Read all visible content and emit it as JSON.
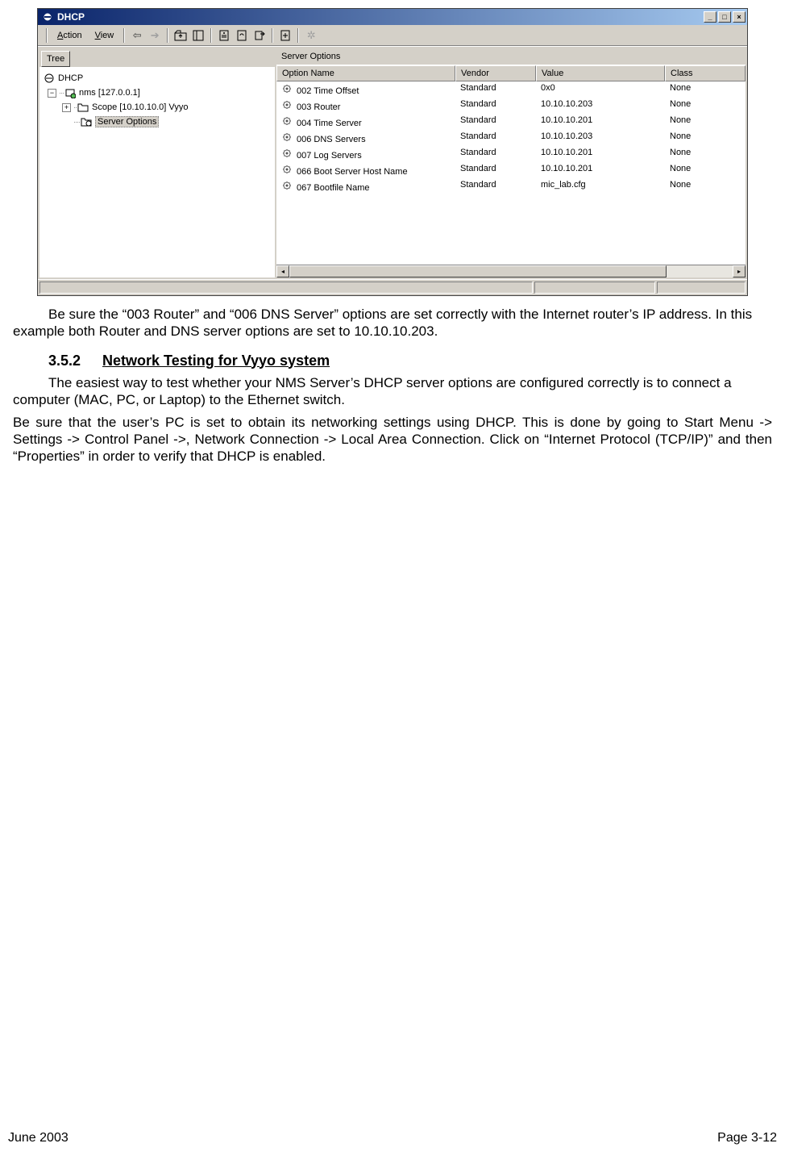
{
  "window": {
    "title": "DHCP",
    "menu": {
      "action": "Action",
      "view": "View"
    },
    "left_tab": "Tree",
    "right_title": "Server Options",
    "tree": {
      "root": "DHCP",
      "node1": "nms [127.0.0.1]",
      "node2": "Scope [10.10.10.0] Vyyo",
      "node3": "Server Options"
    },
    "columns": {
      "name": "Option Name",
      "vendor": "Vendor",
      "value": "Value",
      "class": "Class"
    },
    "rows": [
      {
        "name": "002 Time Offset",
        "vendor": "Standard",
        "value": "0x0",
        "class": "None"
      },
      {
        "name": "003 Router",
        "vendor": "Standard",
        "value": "10.10.10.203",
        "class": "None"
      },
      {
        "name": "004 Time Server",
        "vendor": "Standard",
        "value": "10.10.10.201",
        "class": "None"
      },
      {
        "name": "006 DNS Servers",
        "vendor": "Standard",
        "value": "10.10.10.203",
        "class": "None"
      },
      {
        "name": "007 Log Servers",
        "vendor": "Standard",
        "value": "10.10.10.201",
        "class": "None"
      },
      {
        "name": "066 Boot Server Host Name",
        "vendor": "Standard",
        "value": "10.10.10.201",
        "class": "None"
      },
      {
        "name": "067 Bootfile Name",
        "vendor": "Standard",
        "value": "mic_lab.cfg",
        "class": "None"
      }
    ]
  },
  "doc": {
    "p1": "Be sure the “003 Router” and “006 DNS Server” options are set correctly with the Internet router’s IP address.  In this example both Router and DNS server options are set to 10.10.10.203.",
    "h_num": "3.5.2",
    "h_title": "Network Testing for Vyyo system",
    "p2": "The easiest way to test whether your NMS Server’s DHCP server options are configured correctly is to connect a computer (MAC, PC, or Laptop) to the Ethernet switch.",
    "p3": "Be sure that the user’s PC is set to obtain its networking settings using DHCP.  This is done by going to Start Menu -> Settings -> Control Panel ->, Network Connection -> Local Area Connection.  Click on “Internet Protocol (TCP/IP)” and then “Properties” in order to verify that DHCP is enabled."
  },
  "footer": {
    "left": "June 2003",
    "right": "Page 3-12"
  }
}
